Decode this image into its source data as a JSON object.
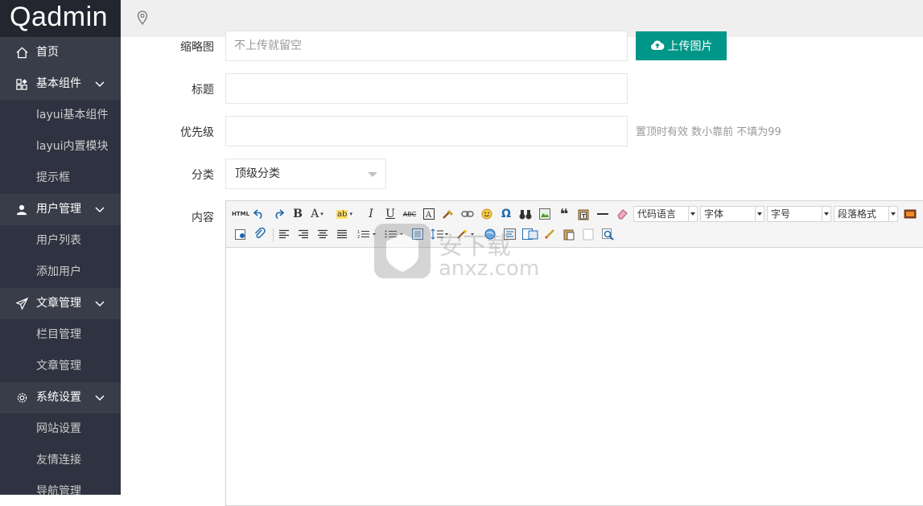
{
  "app": {
    "logo": "Qadmin"
  },
  "sidebar": {
    "items": [
      {
        "label": "首页",
        "type": "top"
      },
      {
        "label": "基本组件",
        "type": "group"
      },
      {
        "label": "layui基本组件",
        "type": "sub"
      },
      {
        "label": "layui内置模块",
        "type": "sub"
      },
      {
        "label": "提示框",
        "type": "sub"
      },
      {
        "label": "用户管理",
        "type": "group"
      },
      {
        "label": "用户列表",
        "type": "sub"
      },
      {
        "label": "添加用户",
        "type": "sub"
      },
      {
        "label": "文章管理",
        "type": "group"
      },
      {
        "label": "栏目管理",
        "type": "sub"
      },
      {
        "label": "文章管理",
        "type": "sub"
      },
      {
        "label": "系统设置",
        "type": "group"
      },
      {
        "label": "网站设置",
        "type": "sub"
      },
      {
        "label": "友情连接",
        "type": "sub"
      },
      {
        "label": "导航管理",
        "type": "sub"
      }
    ]
  },
  "form": {
    "thumbnail": {
      "label": "缩略图",
      "placeholder": "不上传就留空",
      "upload_button": "上传图片"
    },
    "title": {
      "label": "标题",
      "value": ""
    },
    "priority": {
      "label": "优先级",
      "value": "",
      "hint": "置顶时有效 数小靠前 不填为99"
    },
    "category": {
      "label": "分类",
      "selected": "顶级分类"
    },
    "content": {
      "label": "内容"
    }
  },
  "editor": {
    "combos": {
      "code_language": "代码语言",
      "font_family": "字体",
      "font_size": "字号",
      "paragraph_format": "段落格式"
    },
    "html_button": "HTML"
  },
  "watermark": {
    "text": "anxz.com"
  },
  "colors": {
    "sidebar_bg": "#393D49",
    "sub_bg": "#2F3240",
    "logo_bg": "#23262E",
    "accent": "#009688"
  }
}
